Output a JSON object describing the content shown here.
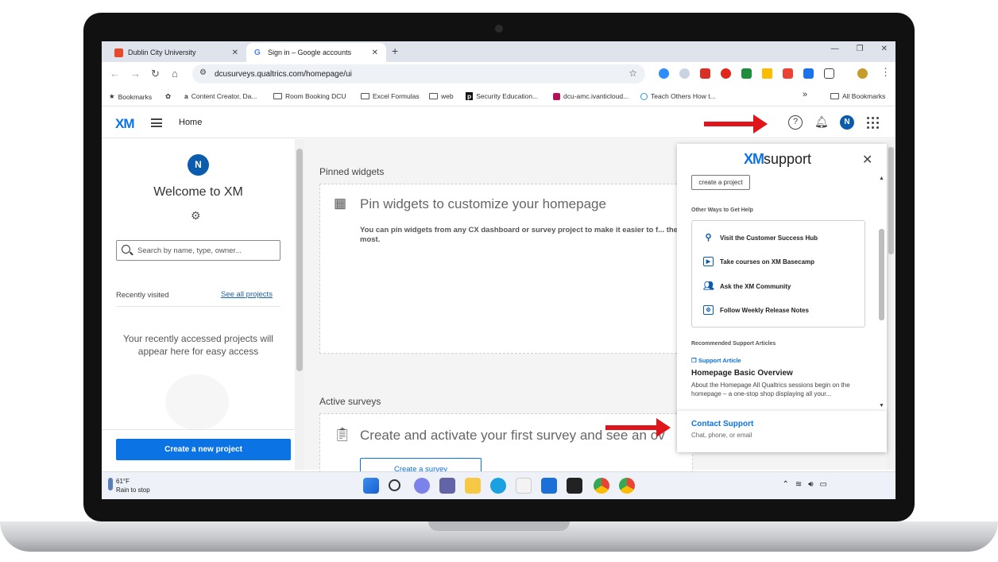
{
  "browser": {
    "tabs": [
      {
        "title": "Dublin City University",
        "favicon_color": "#e8492c"
      },
      {
        "title": "Sign in – Google accounts",
        "favicon_color": "#4285f4"
      }
    ],
    "address": "dcusurveys.qualtrics.com/homepage/ui",
    "bookmarks": [
      {
        "label": "Bookmarks",
        "icon": "star-icon"
      },
      {
        "label": "Content Creator, Da...",
        "icon": "amazon-icon"
      },
      {
        "label": "Room Booking DCU",
        "icon": "folder-icon"
      },
      {
        "label": "Excel Formulas",
        "icon": "folder-icon"
      },
      {
        "label": "web",
        "icon": "folder-icon"
      },
      {
        "label": "Security Education...",
        "icon": "p-icon"
      },
      {
        "label": "dcu-amc.ivanticloud...",
        "icon": "ivanti-icon"
      },
      {
        "label": "Teach Others How t...",
        "icon": "circle-icon"
      },
      {
        "label": "»",
        "icon": "overflow-icon"
      },
      {
        "label": "All Bookmarks",
        "icon": "folder-icon"
      }
    ]
  },
  "app": {
    "logo": "XM",
    "nav_title": "Home",
    "avatar_initial": "N",
    "colors": {
      "brand": "#0b73e3",
      "avatar": "#0b5cad",
      "arrow": "#e0141b"
    }
  },
  "left_panel": {
    "avatar_initial": "N",
    "welcome": "Welcome to XM",
    "search_placeholder": "Search by name, type, owner...",
    "recently_visited": "Recently visited",
    "see_all": "See all projects",
    "empty_text": "Your recently accessed projects will appear here for easy access",
    "create_button": "Create a new project"
  },
  "main": {
    "pinned_heading": "Pinned widgets",
    "pinned_title": "Pin widgets to customize your homepage",
    "pinned_text": "You can pin widgets from any CX dashboard or survey project to make it easier to f... the most.",
    "active_heading": "Active surveys",
    "active_title": "Create and activate your first survey and see an ov",
    "create_survey": "Create a survey"
  },
  "support": {
    "brand": "XM",
    "title": "support",
    "create_project": "create a project",
    "other_ways_title": "Other Ways to Get Help",
    "other_ways": [
      {
        "label": "Visit the Customer Success Hub",
        "icon": "hub-icon"
      },
      {
        "label": "Take courses on XM Basecamp",
        "icon": "play-icon"
      },
      {
        "label": "Ask the XM Community",
        "icon": "people-icon"
      },
      {
        "label": "Follow Weekly Release Notes",
        "icon": "calendar-icon"
      }
    ],
    "recommended_title": "Recommended Support Articles",
    "article_tag": "Support Article",
    "article_title": "Homepage Basic Overview",
    "article_desc": "About the Homepage All Qualtrics sessions begin on the homepage – a one-stop shop displaying all your...",
    "contact_title": "Contact Support",
    "contact_sub": "Chat, phone, or email"
  },
  "taskbar": {
    "temp": "61°F",
    "weather": "Rain to stop"
  }
}
